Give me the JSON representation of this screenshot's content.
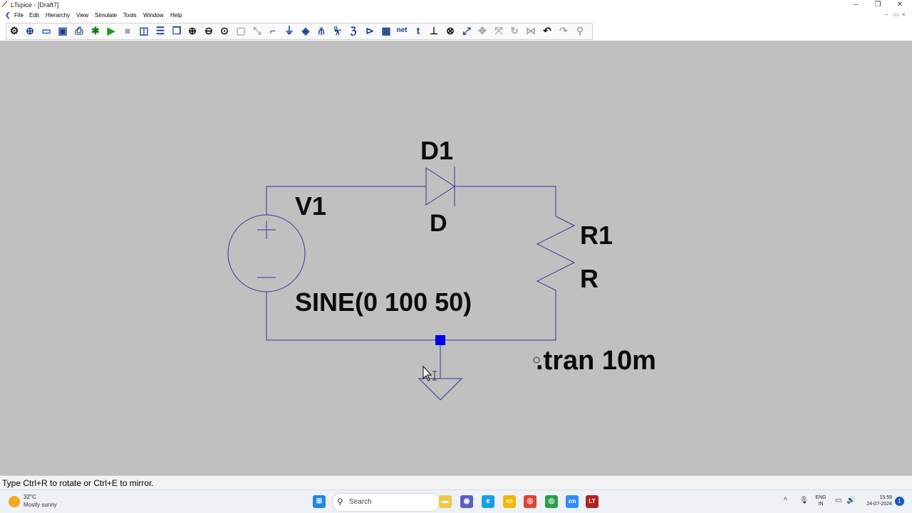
{
  "window": {
    "title": "LTspice - [Draft7]",
    "app_icon": "ltspice-logo-icon",
    "controls": [
      "–",
      "❐",
      "✕"
    ],
    "mdi_controls": [
      "–",
      "▭",
      "×"
    ]
  },
  "menu": {
    "items": [
      "File",
      "Edit",
      "Hierarchy",
      "View",
      "Simulate",
      "Tools",
      "Window",
      "Help"
    ]
  },
  "toolbar": {
    "net_label": "net",
    "text_label": "t",
    "buttons": [
      {
        "name": "settings-icon",
        "glyph": "⚙",
        "color": "#111111"
      },
      {
        "name": "new-schematic-icon",
        "glyph": "⊕",
        "color": "#1b3d8f"
      },
      {
        "name": "open-icon",
        "glyph": "▭",
        "color": "#1b5fbf"
      },
      {
        "name": "save-icon",
        "glyph": "▣",
        "color": "#1b3d8f"
      },
      {
        "name": "print-icon",
        "glyph": "⎙",
        "color": "#1b3d8f"
      },
      {
        "name": "control-panel-icon",
        "glyph": "✱",
        "color": "#1e7a1e"
      },
      {
        "name": "run-icon",
        "glyph": "▶",
        "color": "#1c9a1c"
      },
      {
        "name": "halt-icon",
        "glyph": "■",
        "color": "#a8a8a8"
      },
      {
        "name": "tile-vertical-icon",
        "glyph": "◫",
        "color": "#1b3d8f"
      },
      {
        "name": "tile-horizontal-icon",
        "glyph": "☰",
        "color": "#1b3d8f"
      },
      {
        "name": "cascade-icon",
        "glyph": "❐",
        "color": "#1b3d8f"
      },
      {
        "name": "zoom-in-icon",
        "glyph": "⊕",
        "color": "#111111"
      },
      {
        "name": "zoom-out-icon",
        "glyph": "⊖",
        "color": "#111111"
      },
      {
        "name": "zoom-fit-icon",
        "glyph": "⊙",
        "color": "#111111"
      },
      {
        "name": "zoom-box-icon",
        "glyph": "▢",
        "color": "#a8a8a8"
      },
      {
        "name": "autorange-icon",
        "glyph": "⤡",
        "color": "#a8a8a8"
      },
      {
        "name": "wire-icon",
        "glyph": "⌐",
        "color": "#1b3d8f"
      },
      {
        "name": "ground-icon",
        "glyph": "⏚",
        "color": "#1b3d8f"
      },
      {
        "name": "label-net-icon",
        "glyph": "◈",
        "color": "#1b3d8f"
      },
      {
        "name": "resistor-icon",
        "glyph": "⫚",
        "color": "#1b3d8f"
      },
      {
        "name": "capacitor-icon",
        "glyph": "⏧",
        "color": "#1b3d8f"
      },
      {
        "name": "inductor-icon",
        "glyph": "ℨ",
        "color": "#1b3d8f"
      },
      {
        "name": "diode-icon",
        "glyph": "⊳",
        "color": "#1b3d8f"
      },
      {
        "name": "component-icon",
        "glyph": "▦",
        "color": "#1b3d8f"
      },
      {
        "name": "net-label-icon",
        "glyph": "net",
        "color": "#1b3d8f"
      },
      {
        "name": "text-icon",
        "glyph": "t",
        "color": "#1b3d8f"
      },
      {
        "name": "spice-directive-icon",
        "glyph": "⊥",
        "color": "#111111"
      },
      {
        "name": "delete-icon",
        "glyph": "⊗",
        "color": "#111111"
      },
      {
        "name": "duplicate-icon",
        "glyph": "⤢",
        "color": "#1b3d8f"
      },
      {
        "name": "move-icon",
        "glyph": "✥",
        "color": "#a8a8a8"
      },
      {
        "name": "drag-icon",
        "glyph": "⤧",
        "color": "#a8a8a8"
      },
      {
        "name": "rotate-icon",
        "glyph": "↻",
        "color": "#a8a8a8"
      },
      {
        "name": "mirror-icon",
        "glyph": "⋈",
        "color": "#a8a8a8"
      },
      {
        "name": "undo-icon",
        "glyph": "↶",
        "color": "#111111"
      },
      {
        "name": "redo-icon",
        "glyph": "↷",
        "color": "#a8a8a8"
      },
      {
        "name": "find-icon",
        "glyph": "⚲",
        "color": "#a8a8a8"
      }
    ]
  },
  "schematic": {
    "wire_color": "#2a3a9a",
    "canvas_color": "#c0c0c0",
    "junction_color": "#0000ee",
    "diode_ref": "D1",
    "diode_value": "D",
    "source_ref": "V1",
    "source_value": "SINE(0 100 50)",
    "resistor_ref": "R1",
    "resistor_value": "R",
    "directive": ".tran 10m"
  },
  "status": {
    "message": "Type Ctrl+R to rotate or Ctrl+E to mirror."
  },
  "taskbar": {
    "weather_temp": "32°C",
    "weather_cond": "Mostly sunny",
    "search_placeholder": "Search",
    "lang_top": "ENG",
    "lang_bottom": "IN",
    "time": "15:59",
    "date": "24-07-2024",
    "notifications": "1",
    "apps": [
      {
        "name": "start-icon",
        "color": "#1e88e5",
        "glyph": "⊞"
      },
      {
        "name": "file-explorer-app-icon",
        "color": "#f5c542",
        "glyph": "▬"
      },
      {
        "name": "chat-app-icon",
        "color": "#5b5fc7",
        "glyph": "◉"
      },
      {
        "name": "edge-app-icon",
        "color": "#1b9de2",
        "glyph": "e"
      },
      {
        "name": "folder-app-icon",
        "color": "#f2b705",
        "glyph": "▭"
      },
      {
        "name": "chrome-app-icon",
        "color": "#e04436",
        "glyph": "◎"
      },
      {
        "name": "chrome-profile-app-icon",
        "color": "#2a9d4a",
        "glyph": "◎"
      },
      {
        "name": "zoom-app-icon",
        "color": "#2d8cff",
        "glyph": "zm"
      },
      {
        "name": "ltspice-app-icon",
        "color": "#b22222",
        "glyph": "LT"
      }
    ]
  }
}
